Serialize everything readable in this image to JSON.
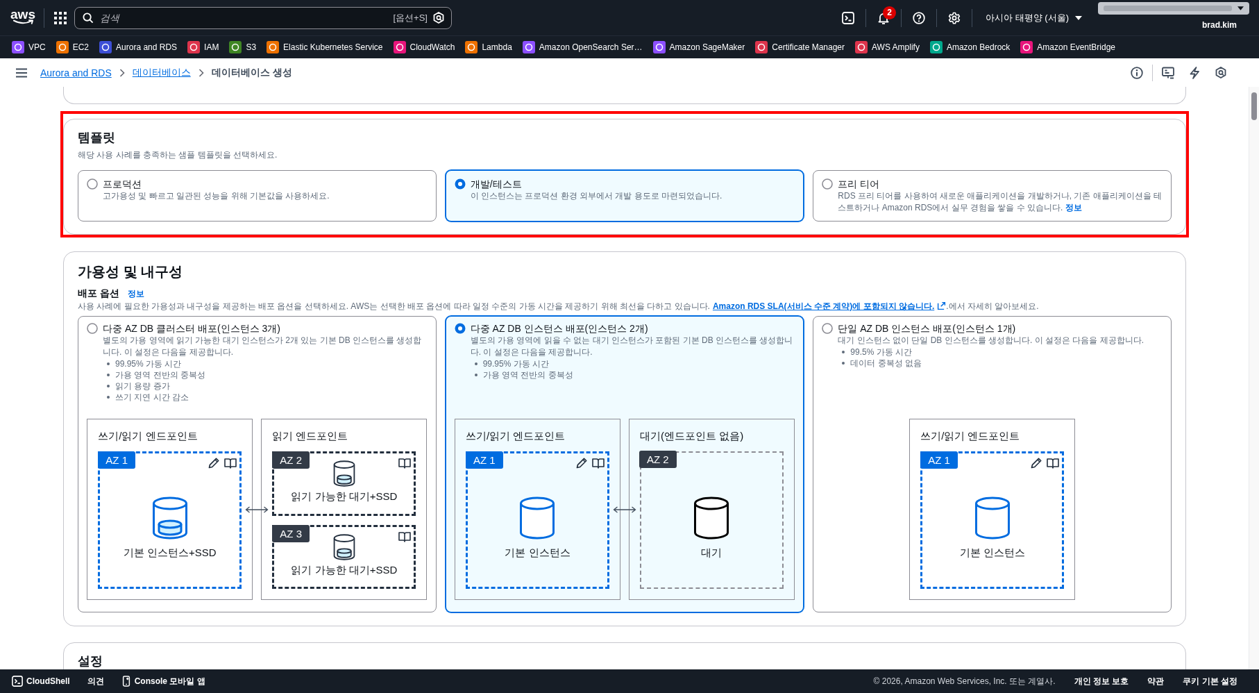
{
  "top_nav": {
    "logo": "aws",
    "search": {
      "placeholder": "검색",
      "shortcut": "[옵션+S]"
    },
    "notifications": {
      "count": "2"
    },
    "region": "아시아 태평양 (서울)",
    "user": "brad.kim"
  },
  "favorites": [
    {
      "label": "VPC",
      "color": "#8c4fff"
    },
    {
      "label": "EC2",
      "color": "#ed7100"
    },
    {
      "label": "Aurora and RDS",
      "color": "#3d4fd6"
    },
    {
      "label": "IAM",
      "color": "#dd344c"
    },
    {
      "label": "S3",
      "color": "#3f8624"
    },
    {
      "label": "Elastic Kubernetes Service",
      "color": "#ed7100"
    },
    {
      "label": "CloudWatch",
      "color": "#e7157b"
    },
    {
      "label": "Lambda",
      "color": "#ed7100"
    },
    {
      "label": "Amazon OpenSearch Ser…",
      "color": "#8c4fff"
    },
    {
      "label": "Amazon SageMaker",
      "color": "#8c4fff"
    },
    {
      "label": "Certificate Manager",
      "color": "#dd344c"
    },
    {
      "label": "AWS Amplify",
      "color": "#dd344c"
    },
    {
      "label": "Amazon Bedrock",
      "color": "#01a88d"
    },
    {
      "label": "Amazon EventBridge",
      "color": "#e7157b"
    }
  ],
  "breadcrumbs": [
    {
      "label": "Aurora and RDS",
      "kind": "link"
    },
    {
      "label": "데이터베이스",
      "kind": "link"
    },
    {
      "label": "데이터베이스 생성",
      "kind": "current"
    }
  ],
  "templates": {
    "highlighted": true,
    "title": "템플릿",
    "description": "해당 사용 사례를 충족하는 샘플 템플릿을 선택하세요.",
    "options": [
      {
        "title": "프로덕션",
        "description": "고가용성 및 빠르고 일관된 성능을 위해 기본값을 사용하세요.",
        "selected": false
      },
      {
        "title": "개발/테스트",
        "description": "이 인스턴스는 프로덕션 환경 외부에서 개발 용도로 마련되었습니다.",
        "selected": true
      },
      {
        "title": "프리 티어",
        "description": "RDS 프리 티어를 사용하여 새로운 애플리케이션을 개발하거나, 기존 애플리케이션을 테스트하거나 Amazon RDS에서 실무 경험을 쌓을 수 있습니다.",
        "link": "정보",
        "selected": false
      }
    ]
  },
  "availability": {
    "title": "가용성 및 내구성",
    "field_label": "배포 옵션",
    "info_link": "정보",
    "description": "사용 사례에 필요한 가용성과 내구성을 제공하는 배포 옵션을 선택하세요. AWS는 선택한 배포 옵션에 따라 일정 수준의 가동 시간을 제공하기 위해 최선을 다하고 있습니다.",
    "description_link": "Amazon RDS SLA(서비스 수준 계약)에 포함되지 않습니다.",
    "description_after": ".에서 자세히 알아보세요.",
    "options": [
      {
        "title": "다중 AZ DB 클러스터 배포(인스턴스 3개)",
        "description": "별도의 가용 영역에 읽기 가능한 대기 인스턴스가 2개 있는 기본 DB 인스턴스를 생성합니다. 이 설정은 다음을 제공합니다.",
        "bullets": [
          "99.95% 가동 시간",
          "가용 영역 전반의 중복성",
          "읽기 용량 증가",
          "쓰기 지연 시간 감소"
        ],
        "selected": false,
        "diagram": [
          {
            "title": "쓰기/읽기 엔드포인트",
            "zones": [
              {
                "label": "AZ 1",
                "kind": "primary",
                "instance": "기본 인스턴스+SSD",
                "ssd": true
              }
            ]
          },
          {
            "title": "읽기 엔드포인트",
            "zones": [
              {
                "label": "AZ 2",
                "kind": "readable",
                "instance": "읽기 가능한 대기+SSD",
                "ssd": true
              },
              {
                "label": "AZ 3",
                "kind": "readable",
                "instance": "읽기 가능한 대기+SSD",
                "ssd": true
              }
            ]
          }
        ]
      },
      {
        "title": "다중 AZ DB 인스턴스 배포(인스턴스 2개)",
        "description": "별도의 가용 영역에 읽을 수 없는 대기 인스턴스가 포함된 기본 DB 인스턴스를 생성합니다. 이 설정은 다음을 제공합니다.",
        "bullets": [
          "99.95% 가동 시간",
          "가용 영역 전반의 중복성"
        ],
        "selected": true,
        "diagram": [
          {
            "title": "쓰기/읽기 엔드포인트",
            "zones": [
              {
                "label": "AZ 1",
                "kind": "primary",
                "instance": "기본 인스턴스",
                "ssd": false
              }
            ]
          },
          {
            "title": "대기(엔드포인트 없음)",
            "zones": [
              {
                "label": "AZ 2",
                "kind": "standby",
                "instance": "대기",
                "ssd": false
              }
            ]
          }
        ]
      },
      {
        "title": "단일 AZ DB 인스턴스 배포(인스턴스 1개)",
        "description": "대기 인스턴스 없이 단일 DB 인스턴스를 생성합니다. 이 설정은 다음을 제공합니다.",
        "bullets": [
          "99.5% 가동 시간",
          "데이터 중복성 없음"
        ],
        "selected": false,
        "diagram": [
          {
            "title": "쓰기/읽기 엔드포인트",
            "zones": [
              {
                "label": "AZ 1",
                "kind": "primary",
                "instance": "기본 인스턴스",
                "ssd": false
              }
            ]
          }
        ]
      }
    ]
  },
  "settings": {
    "title": "설정"
  },
  "footer": {
    "items": [
      {
        "label": "CloudShell",
        "kind": "cloudshell"
      },
      {
        "label": "의견",
        "kind": "text"
      },
      {
        "label": "Console 모바일 앱",
        "kind": "mobile"
      }
    ],
    "copyright": "© 2026, Amazon Web Services, Inc. 또는 계열사.",
    "links": [
      "개인 정보 보호",
      "약관",
      "쿠키 기본 설정"
    ]
  }
}
